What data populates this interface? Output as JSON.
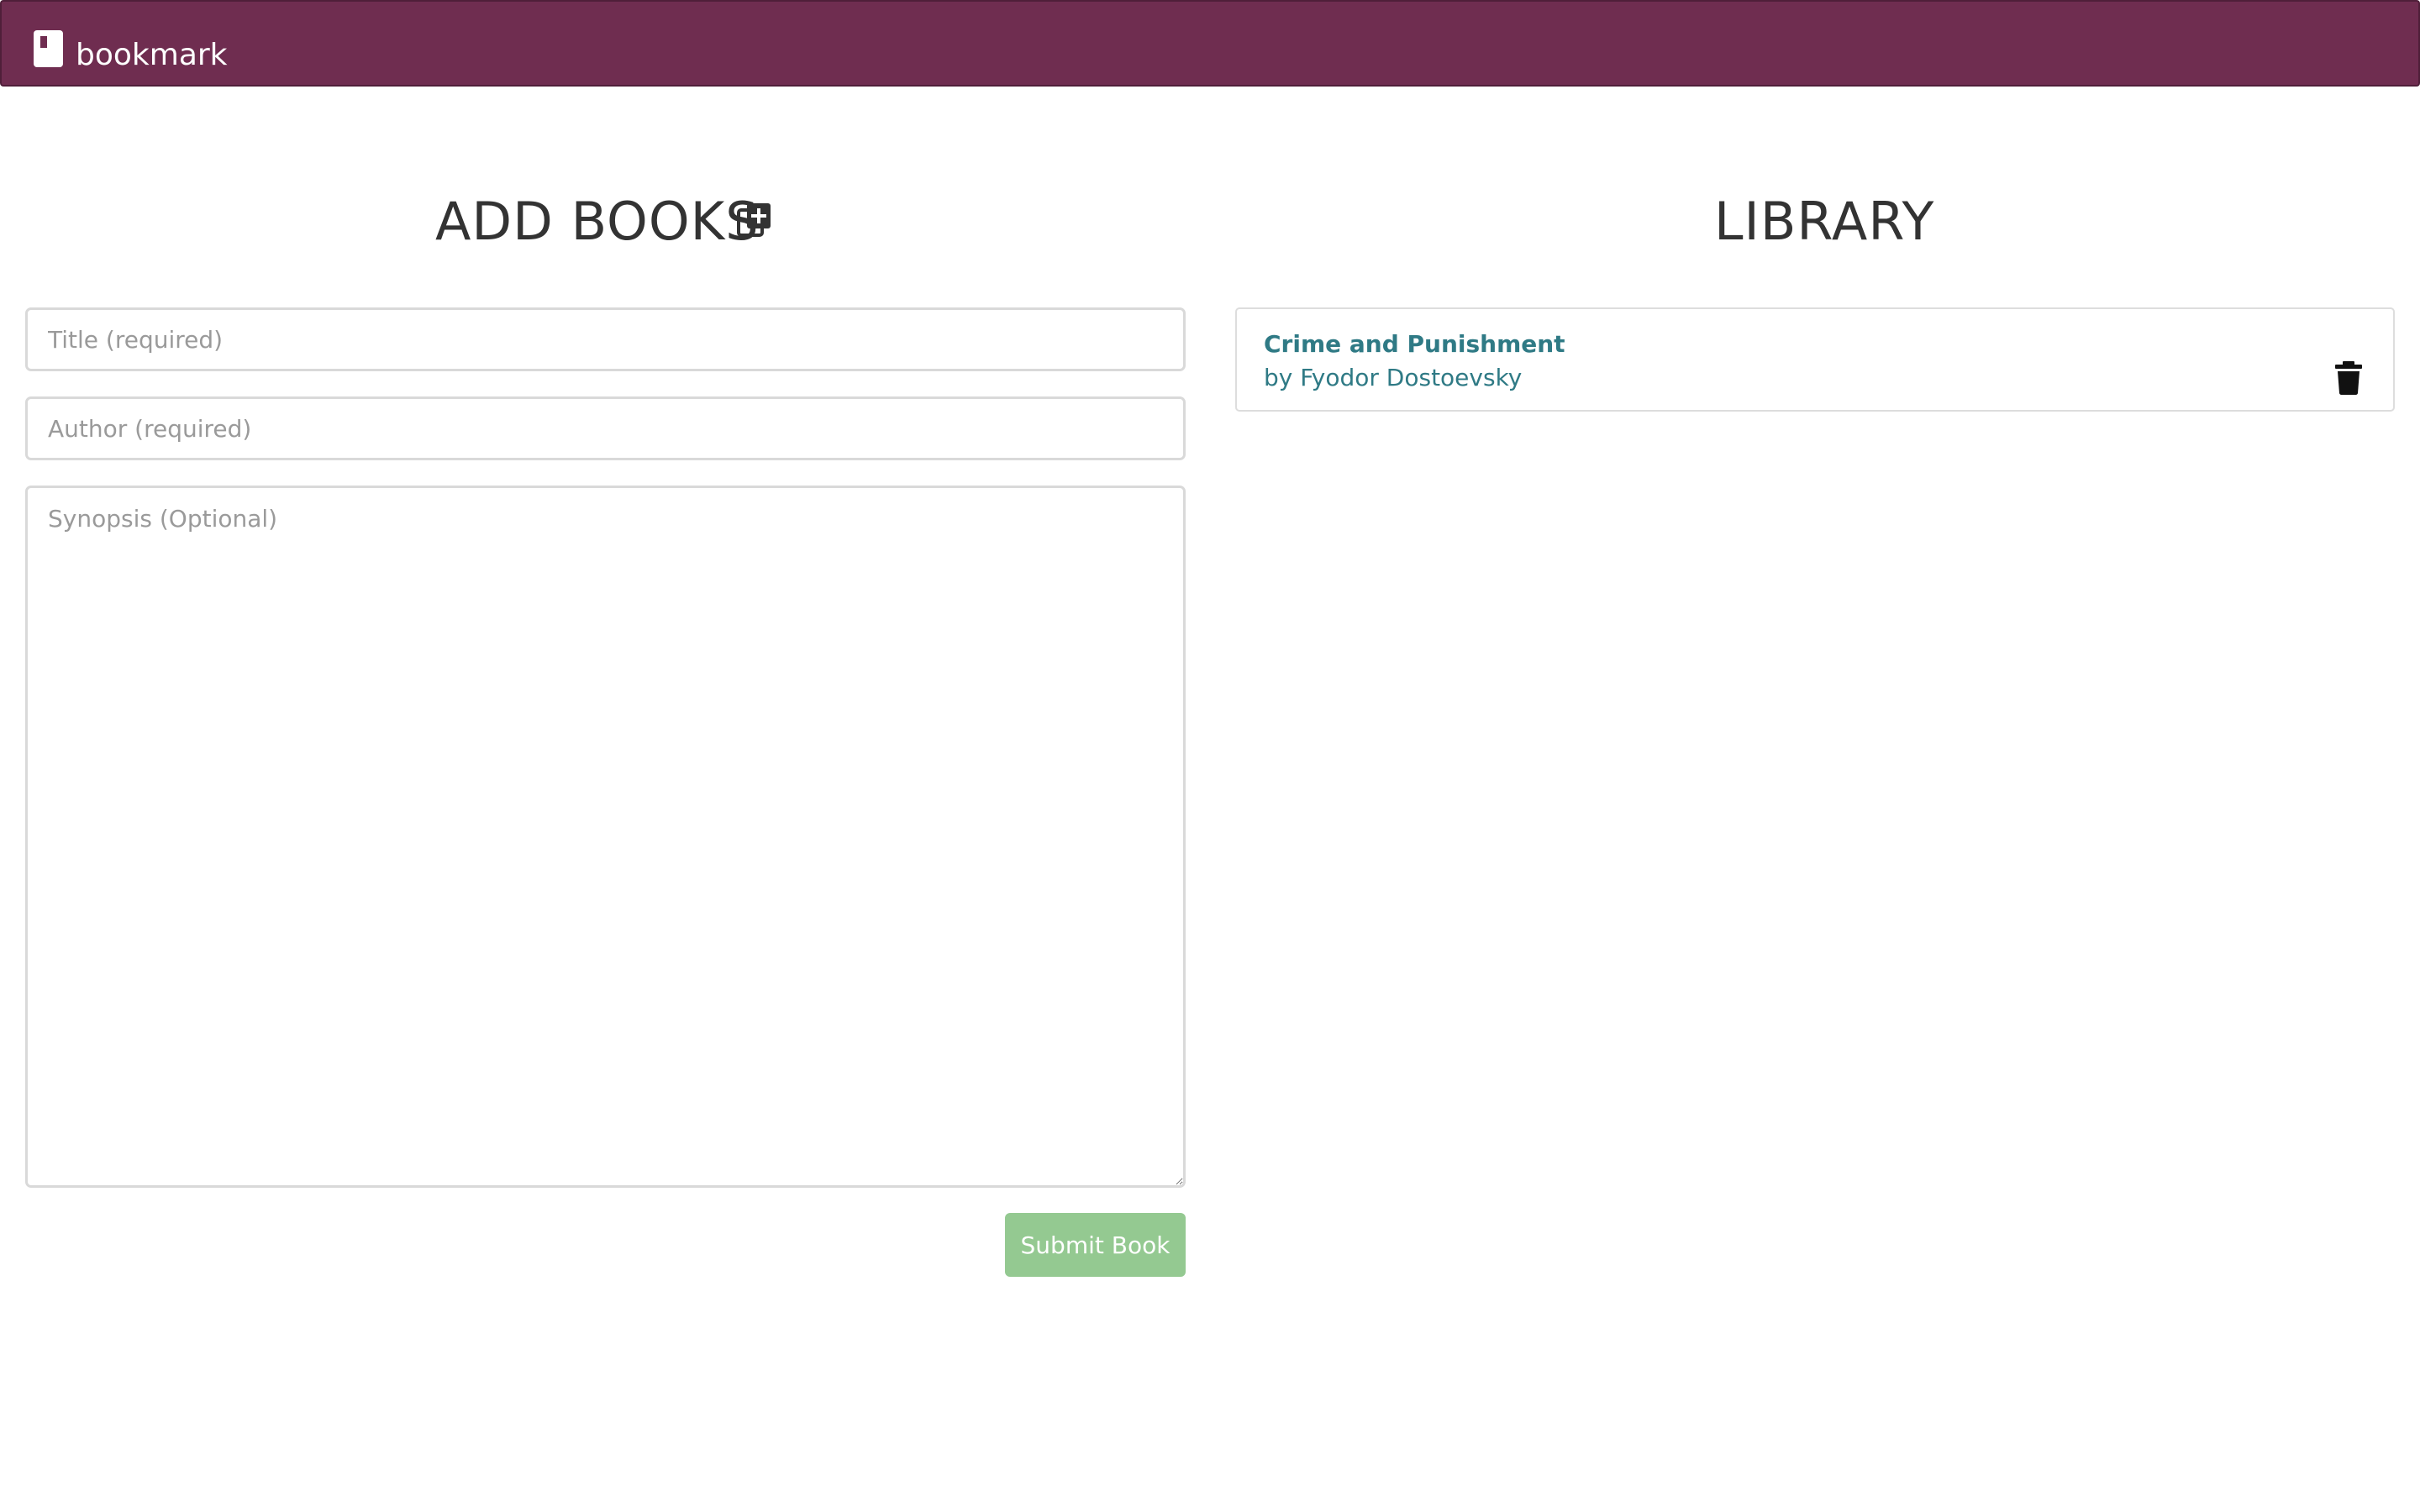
{
  "navbar": {
    "brand": "bookmark",
    "brand_icon": "book-icon",
    "color": "#6f2d50"
  },
  "add_books": {
    "heading": "ADD BOOKS",
    "heading_icon": "add-box-icon",
    "title_placeholder": "Title (required)",
    "author_placeholder": "Author (required)",
    "synopsis_placeholder": "Synopsis (Optional)",
    "submit_label": "Submit Book",
    "submit_color": "#94c991"
  },
  "library": {
    "heading": "LIBRARY",
    "books": [
      {
        "title": "Crime and Punishment",
        "author": "by Fyodor Dostoevsky",
        "delete_icon": "trash-icon"
      }
    ],
    "link_color": "#2f7a85"
  }
}
